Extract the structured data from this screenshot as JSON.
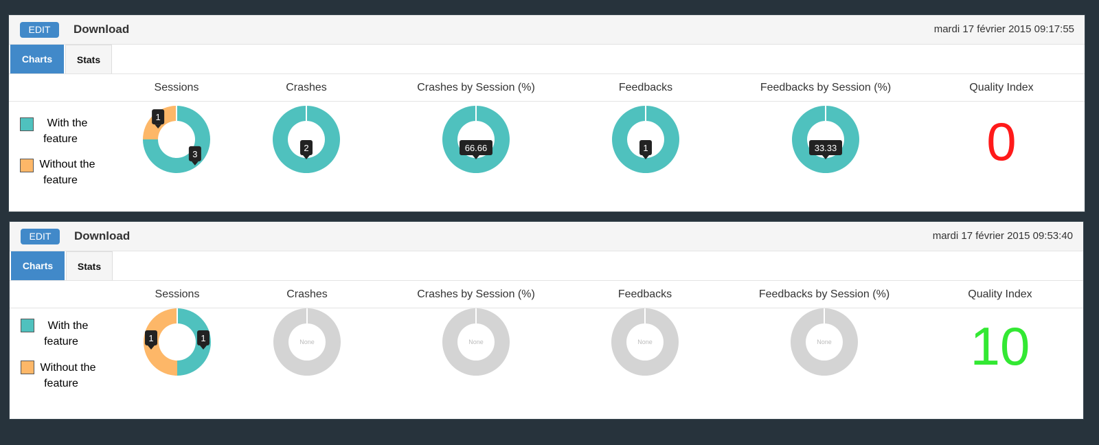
{
  "colors": {
    "accent": "#4189c9",
    "with_feature": "#4fc1be",
    "without_feature": "#fdb768",
    "empty": "#d4d4d4",
    "tooltip": "#222222",
    "quality_bad": "#ff1a1a",
    "quality_good": "#33e833"
  },
  "column_headers": [
    "Sessions",
    "Crashes",
    "Crashes by Session (%)",
    "Feedbacks",
    "Feedbacks by Session (%)",
    "Quality Index"
  ],
  "legend": {
    "with_line1": "With the",
    "with_line2": "feature",
    "without_line1": "Without the",
    "without_line2": "feature"
  },
  "panels": [
    {
      "edit_label": "EDIT",
      "title": "Download",
      "date": "mardi 17 février 2015 09:17:55",
      "tabs": {
        "charts": "Charts",
        "stats": "Stats"
      },
      "quality_index": "0",
      "charts": [
        {
          "name": "Sessions",
          "with": 3,
          "without": 1,
          "labels": [
            "3",
            "1"
          ]
        },
        {
          "name": "Crashes",
          "with": 2,
          "without": 0,
          "labels": [
            "2"
          ]
        },
        {
          "name": "Crashes by Session (%)",
          "with": 66.66,
          "without": 0,
          "labels": [
            "66.66"
          ]
        },
        {
          "name": "Feedbacks",
          "with": 1,
          "without": 0,
          "labels": [
            "1"
          ]
        },
        {
          "name": "Feedbacks by Session (%)",
          "with": 33.33,
          "without": 0,
          "labels": [
            "33.33"
          ]
        }
      ]
    },
    {
      "edit_label": "EDIT",
      "title": "Download",
      "date": "mardi 17 février 2015 09:53:40",
      "tabs": {
        "charts": "Charts",
        "stats": "Stats"
      },
      "quality_index": "10",
      "charts": [
        {
          "name": "Sessions",
          "with": 1,
          "without": 1,
          "labels": [
            "1",
            "1"
          ]
        },
        {
          "name": "Crashes",
          "with": 0,
          "without": 0,
          "empty_label": "None"
        },
        {
          "name": "Crashes by Session (%)",
          "with": 0,
          "without": 0,
          "empty_label": "None"
        },
        {
          "name": "Feedbacks",
          "with": 0,
          "without": 0,
          "empty_label": "None"
        },
        {
          "name": "Feedbacks by Session (%)",
          "with": 0,
          "without": 0,
          "empty_label": "None"
        }
      ]
    }
  ]
}
